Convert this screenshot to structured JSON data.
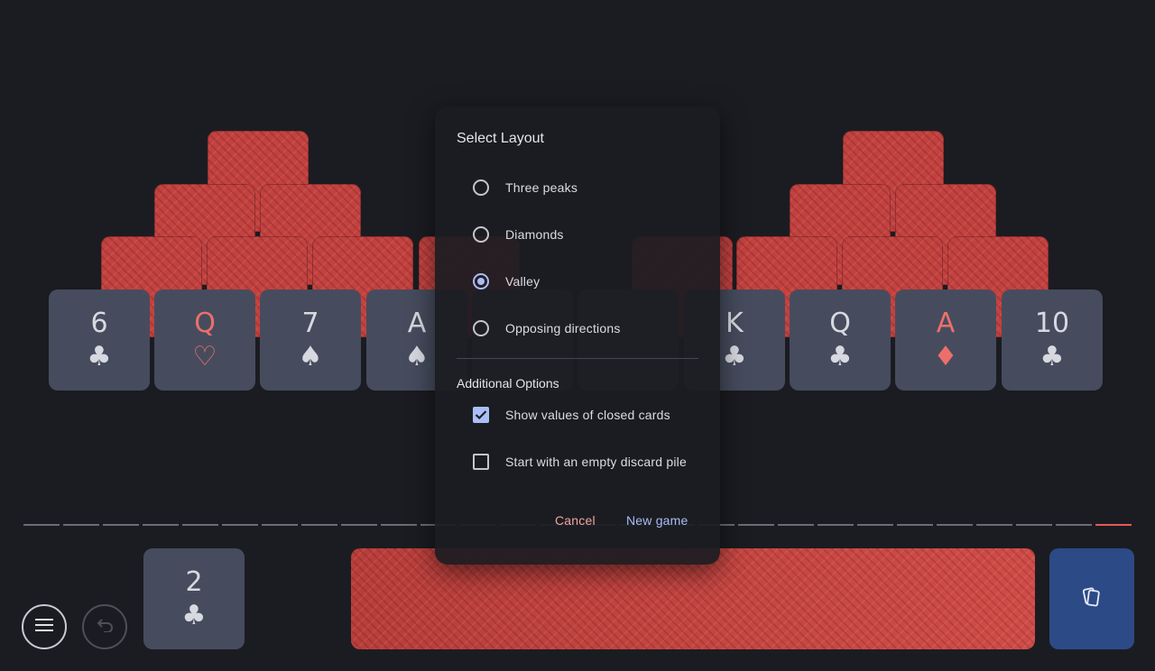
{
  "tableau": {
    "row4": [
      {
        "rank": "6",
        "suit": "♣",
        "red": false
      },
      {
        "rank": "Q",
        "suit": "♡",
        "red": true
      },
      {
        "rank": "7",
        "suit": "♠",
        "red": false
      },
      {
        "rank": "A",
        "suit": "♠",
        "red": false
      },
      {
        "rank": "",
        "suit": "",
        "red": false
      },
      {
        "rank": "",
        "suit": "",
        "red": false
      },
      {
        "rank": "K",
        "suit": "♣",
        "red": false
      },
      {
        "rank": "Q",
        "suit": "♣",
        "red": false
      },
      {
        "rank": "A",
        "suit": "♦",
        "red": true
      },
      {
        "rank": "10",
        "suit": "♣",
        "red": false
      }
    ]
  },
  "waste": {
    "rank": "2",
    "suit": "♣"
  },
  "icons": {
    "menu": "menu-icon",
    "undo": "undo-icon",
    "deal": "cards-icon"
  },
  "dialog": {
    "title": "Select Layout",
    "layouts": [
      {
        "label": "Three peaks",
        "selected": false
      },
      {
        "label": "Diamonds",
        "selected": false
      },
      {
        "label": "Valley",
        "selected": true
      },
      {
        "label": "Opposing directions",
        "selected": false
      }
    ],
    "options_title": "Additional Options",
    "options": [
      {
        "label": "Show values of closed cards",
        "checked": true
      },
      {
        "label": "Start with an empty discard pile",
        "checked": false
      }
    ],
    "cancel_label": "Cancel",
    "confirm_label": "New game"
  },
  "colors": {
    "background": "#1b1c21",
    "card_back": "#c4413f",
    "card_face": "#464c5e",
    "accent": "#a9bdf7",
    "cancel": "#f2a49e",
    "deal_button": "#2c4a86"
  }
}
